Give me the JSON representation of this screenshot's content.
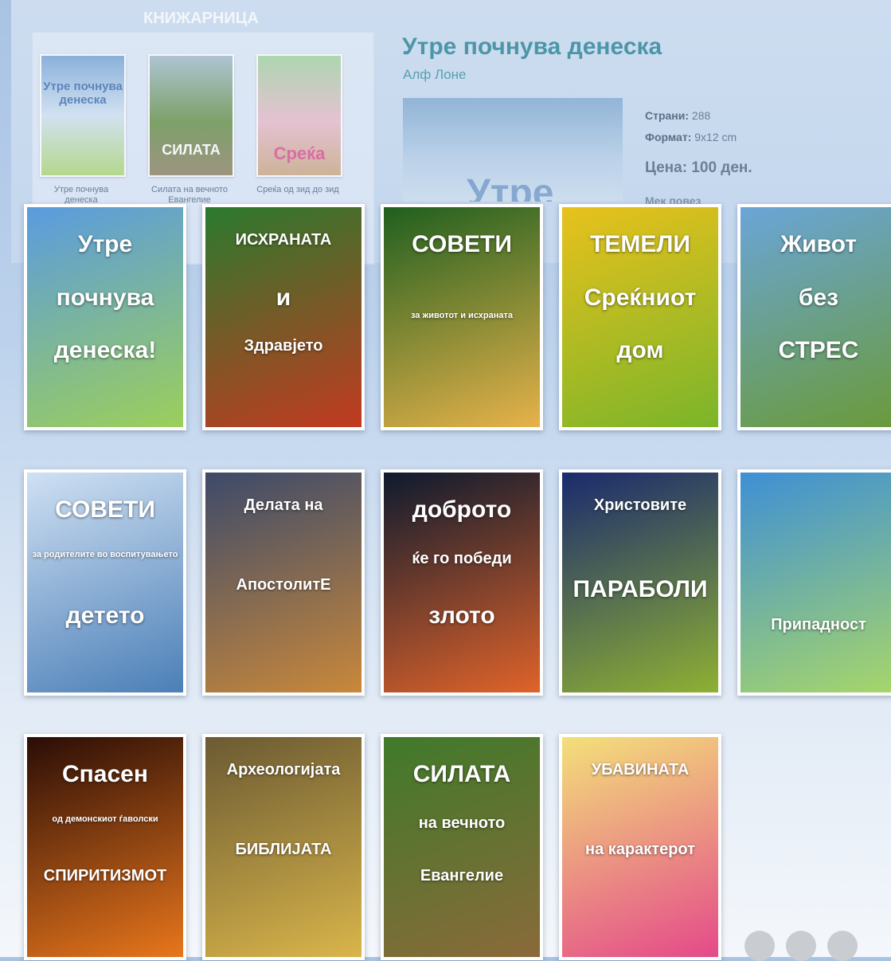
{
  "bookstore": {
    "header": "КНИЖАРНИЦА",
    "thumbnails": [
      {
        "caption": "Утре почнува денеска",
        "cover_text": "Утре почнува денеска"
      },
      {
        "caption": "Силата на вечното Евангелие",
        "cover_text": "СИЛАТА"
      },
      {
        "caption": "Среќа од зид до зид",
        "cover_text": "Среќа"
      }
    ]
  },
  "detail": {
    "title": "Утре почнува денеска",
    "author": "Алф Лоне",
    "pages_label": "Страни:",
    "pages_value": "288",
    "format_label": "Формат:",
    "format_value": "9x12 cm",
    "price": "Цена: 100 ден.",
    "faded": "Мек повез",
    "cover_text": "Утре"
  },
  "covers": [
    {
      "lines": [
        "Утре",
        "почнува",
        "денеска!"
      ],
      "colors": [
        "#5a9be0",
        "#9ccf5a"
      ]
    },
    {
      "lines": [
        "ИСХРАНАТА",
        "и",
        "Здравјето"
      ],
      "colors": [
        "#2b7a2e",
        "#c23a20"
      ]
    },
    {
      "lines": [
        "СОВЕТИ",
        "за животот и исхраната"
      ],
      "colors": [
        "#1f5f1f",
        "#e7b24a"
      ]
    },
    {
      "lines": [
        "ТЕМЕЛИ",
        "Среќниот",
        "дом"
      ],
      "colors": [
        "#e8c11c",
        "#7bb52a"
      ]
    },
    {
      "lines": [
        "Живот",
        "без",
        "СТРЕС"
      ],
      "colors": [
        "#6aa5d8",
        "#6a9a3a"
      ]
    },
    {
      "lines": [
        "СОВЕТИ",
        "за родителите во воспитувањето",
        "детето"
      ],
      "colors": [
        "#cfe0f3",
        "#4b7fb7"
      ]
    },
    {
      "lines": [
        "Делата на",
        "АпостолитЕ"
      ],
      "colors": [
        "#3c4a6a",
        "#c9883a"
      ]
    },
    {
      "lines": [
        "доброто",
        "ќе го победи",
        "злото"
      ],
      "colors": [
        "#0d1a2e",
        "#e0632a"
      ]
    },
    {
      "lines": [
        "Христовите",
        "ПАРАБОЛИ"
      ],
      "colors": [
        "#1a2a6e",
        "#8fb033"
      ]
    },
    {
      "lines": [
        "Припадност"
      ],
      "colors": [
        "#3e8fd6",
        "#a7d66a"
      ]
    },
    {
      "lines": [
        "Спасен",
        "од демонскиот ѓаволски",
        "СПИРИТИЗМОТ"
      ],
      "colors": [
        "#2a0d06",
        "#e8761c"
      ]
    },
    {
      "lines": [
        "Археологијата",
        "БИБЛИЈАТА"
      ],
      "colors": [
        "#6b5a33",
        "#d9b54a"
      ]
    },
    {
      "lines": [
        "СИЛАТА",
        "на вечното",
        "Евангелие"
      ],
      "colors": [
        "#3f7a2a",
        "#8a6a3a"
      ]
    },
    {
      "lines": [
        "УБАВИНАТА",
        "на карактерот"
      ],
      "colors": [
        "#f3e07a",
        "#e44a8a"
      ]
    }
  ],
  "pagination": {
    "icon": "more-dots-icon"
  }
}
